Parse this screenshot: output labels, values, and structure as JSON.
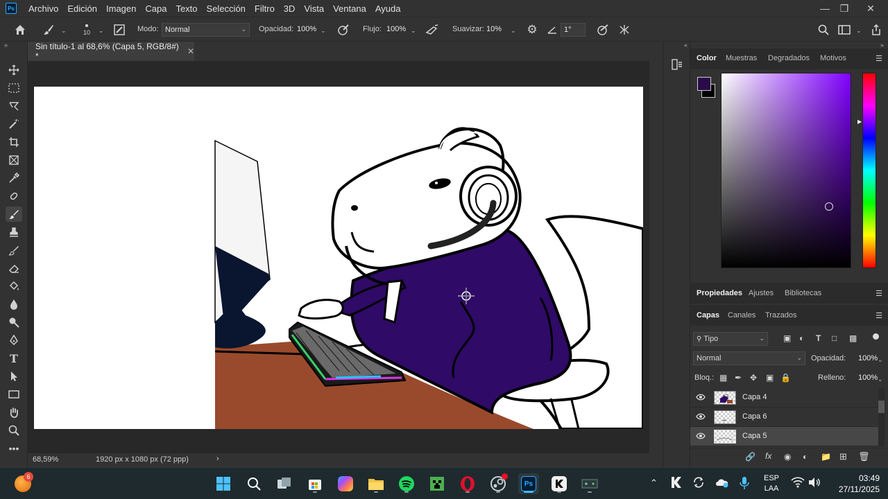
{
  "app": {
    "logo": "Ps"
  },
  "menu": [
    "Archivo",
    "Edición",
    "Imagen",
    "Capa",
    "Texto",
    "Selección",
    "Filtro",
    "3D",
    "Vista",
    "Ventana",
    "Ayuda"
  ],
  "options": {
    "brush_size": "10",
    "mode_label": "Modo:",
    "mode_value": "Normal",
    "opacity_label": "Opacidad:",
    "opacity_value": "100%",
    "flow_label": "Flujo:",
    "flow_value": "100%",
    "smoothing_label": "Suavizar:",
    "smoothing_value": "10%",
    "angle_value": "1°"
  },
  "document": {
    "tab_title": "Sin título-1 al 68,6% (Capa 5, RGB/8#) *",
    "zoom": "68,59%",
    "dimensions": "1920 px x 1080 px (72 ppp)"
  },
  "color_panel": {
    "tabs": [
      "Color",
      "Muestras",
      "Degradados",
      "Motivos"
    ],
    "foreground": "#2a0b4a",
    "background": "#000000",
    "hue": "#8000ff"
  },
  "properties_tabs": [
    "Propiedades",
    "Ajustes",
    "Bibliotecas"
  ],
  "layers_panel": {
    "tabs": [
      "Capas",
      "Canales",
      "Trazados"
    ],
    "filter_label": "Tipo",
    "blend_mode": "Normal",
    "opacity_label": "Opacidad:",
    "opacity_value": "100%",
    "lock_label": "Bloq.:",
    "fill_label": "Relleno:",
    "fill_value": "100%",
    "layers": [
      {
        "name": "Capa 4",
        "visible": true,
        "selected": false
      },
      {
        "name": "Capa 6",
        "visible": true,
        "selected": false
      },
      {
        "name": "Capa 5",
        "visible": true,
        "selected": true
      }
    ]
  },
  "taskbar": {
    "weather_badge": "6",
    "lang_top": "ESP",
    "lang_bottom": "LAA",
    "time": "03:49",
    "date": "27/11/2025"
  },
  "colors": {
    "purple_shirt": "#2f0a66",
    "desk": "#9a4a2c",
    "monitor": "#0a1530"
  }
}
